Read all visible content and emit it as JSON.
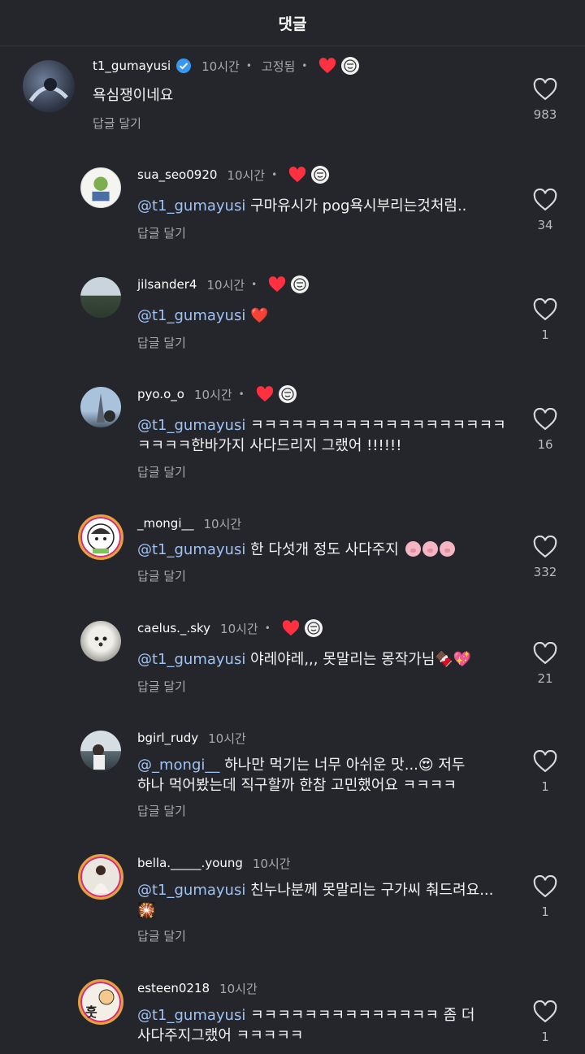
{
  "header": {
    "title": "댓글"
  },
  "comments": [
    {
      "username": "t1_gumayusi",
      "verified": true,
      "time": "10시간",
      "pinned_label": "고정됨",
      "has_creator_like": true,
      "text": "욕심쟁이네요",
      "mention": "",
      "reply_label": "답글 달기",
      "likes": "983"
    },
    {
      "username": "sua_seo0920",
      "time": "10시간",
      "has_creator_like": true,
      "mention": "@t1_gumayusi",
      "text": " 구마유시가 pog욕시부리는것처럼..",
      "reply_label": "답글 달기",
      "likes": "34"
    },
    {
      "username": "jilsander4",
      "time": "10시간",
      "has_creator_like": true,
      "mention": "@t1_gumayusi",
      "text": " ❤️",
      "reply_label": "답글 달기",
      "likes": "1"
    },
    {
      "username": "pyo.o_o",
      "time": "10시간",
      "has_creator_like": true,
      "mention": "@t1_gumayusi",
      "text": " ㅋㅋㅋㅋㅋㅋㅋㅋㅋㅋㅋㅋㅋㅋㅋㅋㅋㅋㅋ",
      "text_line2": "ㅋㅋㅋㅋ한바가지 사다드리지 그랬어 !!!!!!",
      "reply_label": "답글 달기",
      "likes": "16"
    },
    {
      "username": "_mongi__",
      "time": "10시간",
      "has_creator_like": false,
      "mention": "@t1_gumayusi",
      "text": " 한 다섯개 정도 사다주지",
      "reply_label": "답글 달기",
      "likes": "332"
    },
    {
      "username": "caelus._.sky",
      "time": "10시간",
      "has_creator_like": true,
      "mention": "@t1_gumayusi",
      "text": " 야레야레,,, 못말리는 몽작가님🍫💖",
      "reply_label": "답글 달기",
      "likes": "21"
    },
    {
      "username": "bgirl_rudy",
      "time": "10시간",
      "has_creator_like": false,
      "mention": "@_mongi__",
      "text": " 하나만 먹기는 너무 아쉬운 맛...😍 저두",
      "text_line2": "하나 먹어봤는데 직구할까 한참 고민했어요 ㅋㅋㅋㅋ",
      "reply_label": "답글 달기",
      "likes": "1"
    },
    {
      "username": "bella._____.young",
      "time": "10시간",
      "has_creator_like": false,
      "mention": "@t1_gumayusi",
      "text": " 친누나분께 못말리는 구가씨 춰드려요...",
      "text_line2": "🎇",
      "reply_label": "답글 달기",
      "likes": "1"
    },
    {
      "username": "esteen0218",
      "time": "10시간",
      "has_creator_like": false,
      "mention": "@t1_gumayusi",
      "text": " ㅋㅋㅋㅋㅋㅋㅋㅋㅋㅋㅋㅋㅋㅋ 좀 더",
      "text_line2": "사다주지그랬어  ㅋㅋㅋㅋㅋ",
      "reply_label": "",
      "likes": "1",
      "avatar_glyph": "훗"
    }
  ],
  "colors": {
    "background": "#25262b",
    "mention": "#9ec3f5",
    "heart": "#ff3040",
    "verified": "#3897f0",
    "ring": "#e3a33a"
  },
  "icons": {
    "like": "heart-outline-icon",
    "creator_like": "heart-filled-icon",
    "verified": "verified-badge-icon"
  }
}
